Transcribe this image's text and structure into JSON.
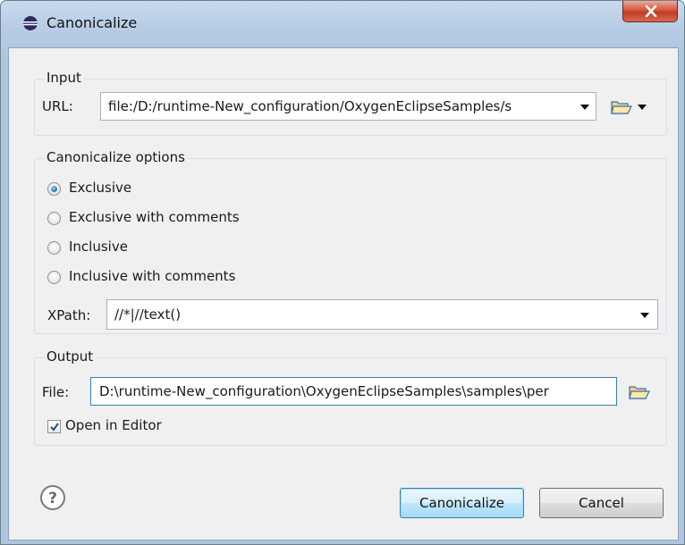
{
  "window": {
    "title": "Canonicalize"
  },
  "input_group": {
    "title": "Input",
    "url_label": "URL:",
    "url_value": "file:/D:/runtime-New_configuration/OxygenEclipseSamples/s"
  },
  "options_group": {
    "title": "Canonicalize options",
    "radios": [
      {
        "label": "Exclusive",
        "checked": true
      },
      {
        "label": "Exclusive with comments",
        "checked": false
      },
      {
        "label": "Inclusive",
        "checked": false
      },
      {
        "label": "Inclusive with comments",
        "checked": false
      }
    ],
    "xpath_label": "XPath:",
    "xpath_value": "//*|//text()"
  },
  "output_group": {
    "title": "Output",
    "file_label": "File:",
    "file_value": "D:\\runtime-New_configuration\\OxygenEclipseSamples\\samples\\per",
    "open_in_editor_label": "Open in Editor",
    "open_in_editor_checked": true
  },
  "buttons": {
    "canonicalize": "Canonicalize",
    "cancel": "Cancel"
  },
  "icons": {
    "title": "eclipse-icon",
    "close": "close-icon",
    "folder": "folder-open-icon",
    "help": "help-icon"
  },
  "colors": {
    "title_bar": "#b7cde5",
    "close_button": "#c23b22",
    "default_button": "#bee6fd",
    "radio_selected": "#2a7fc4"
  }
}
